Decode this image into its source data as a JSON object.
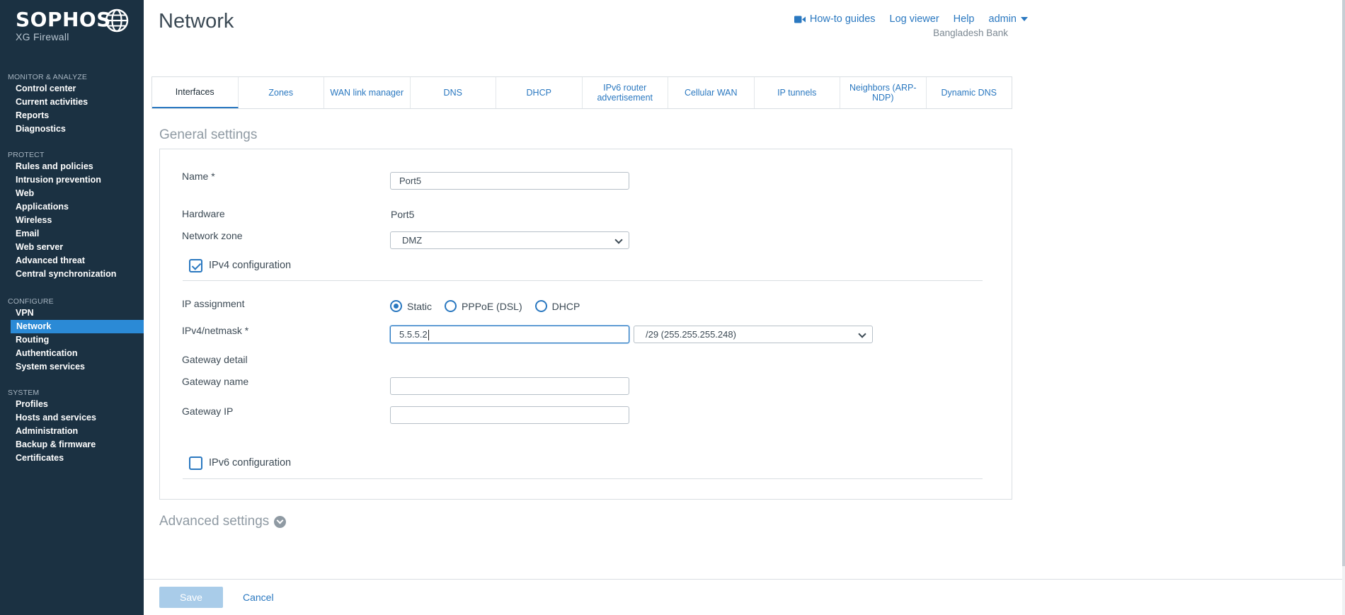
{
  "brand": {
    "name": "SOPHOS",
    "product": "XG Firewall"
  },
  "sidebar": {
    "sections": [
      {
        "heading": "MONITOR & ANALYZE",
        "items": [
          "Control center",
          "Current activities",
          "Reports",
          "Diagnostics"
        ]
      },
      {
        "heading": "PROTECT",
        "items": [
          "Rules and policies",
          "Intrusion prevention",
          "Web",
          "Applications",
          "Wireless",
          "Email",
          "Web server",
          "Advanced threat",
          "Central synchronization"
        ]
      },
      {
        "heading": "CONFIGURE",
        "items": [
          "VPN",
          "Network",
          "Routing",
          "Authentication",
          "System services"
        ]
      },
      {
        "heading": "SYSTEM",
        "items": [
          "Profiles",
          "Hosts and services",
          "Administration",
          "Backup & firmware",
          "Certificates"
        ]
      }
    ],
    "active_item": "Network"
  },
  "header": {
    "title": "Network",
    "links": {
      "howto": "How-to guides",
      "log_viewer": "Log viewer",
      "help": "Help",
      "admin": "admin"
    },
    "organization": "Bangladesh Bank"
  },
  "tabs": [
    "Interfaces",
    "Zones",
    "WAN link manager",
    "DNS",
    "DHCP",
    "IPv6 router advertisement",
    "Cellular WAN",
    "IP tunnels",
    "Neighbors (ARP-NDP)",
    "Dynamic DNS"
  ],
  "active_tab": "Interfaces",
  "general": {
    "title": "General settings",
    "name_label": "Name *",
    "name_value": "Port5",
    "hardware_label": "Hardware",
    "hardware_value": "Port5",
    "zone_label": "Network zone",
    "zone_value": "DMZ",
    "ipv4_config_label": "IPv4 configuration",
    "ipv4_config_checked": true,
    "ip_assignment_label": "IP assignment",
    "ip_assignment_options": [
      "Static",
      "PPPoE (DSL)",
      "DHCP"
    ],
    "ip_assignment_selected": "Static",
    "ipv4_label": "IPv4/netmask *",
    "ipv4_value": "5.5.5.2",
    "netmask_value": "/29 (255.255.255.248)",
    "gateway_detail_label": "Gateway detail",
    "gateway_name_label": "Gateway name",
    "gateway_name_value": "",
    "gateway_ip_label": "Gateway IP",
    "gateway_ip_value": "",
    "ipv6_config_label": "IPv6 configuration",
    "ipv6_config_checked": false
  },
  "advanced": {
    "title": "Advanced settings"
  },
  "footer": {
    "save": "Save",
    "cancel": "Cancel"
  },
  "colors": {
    "sidebar_bg": "#1b3142",
    "accent": "#2a78c0",
    "active_nav": "#2b8ad6",
    "save_disabled": "#a9cce9"
  }
}
